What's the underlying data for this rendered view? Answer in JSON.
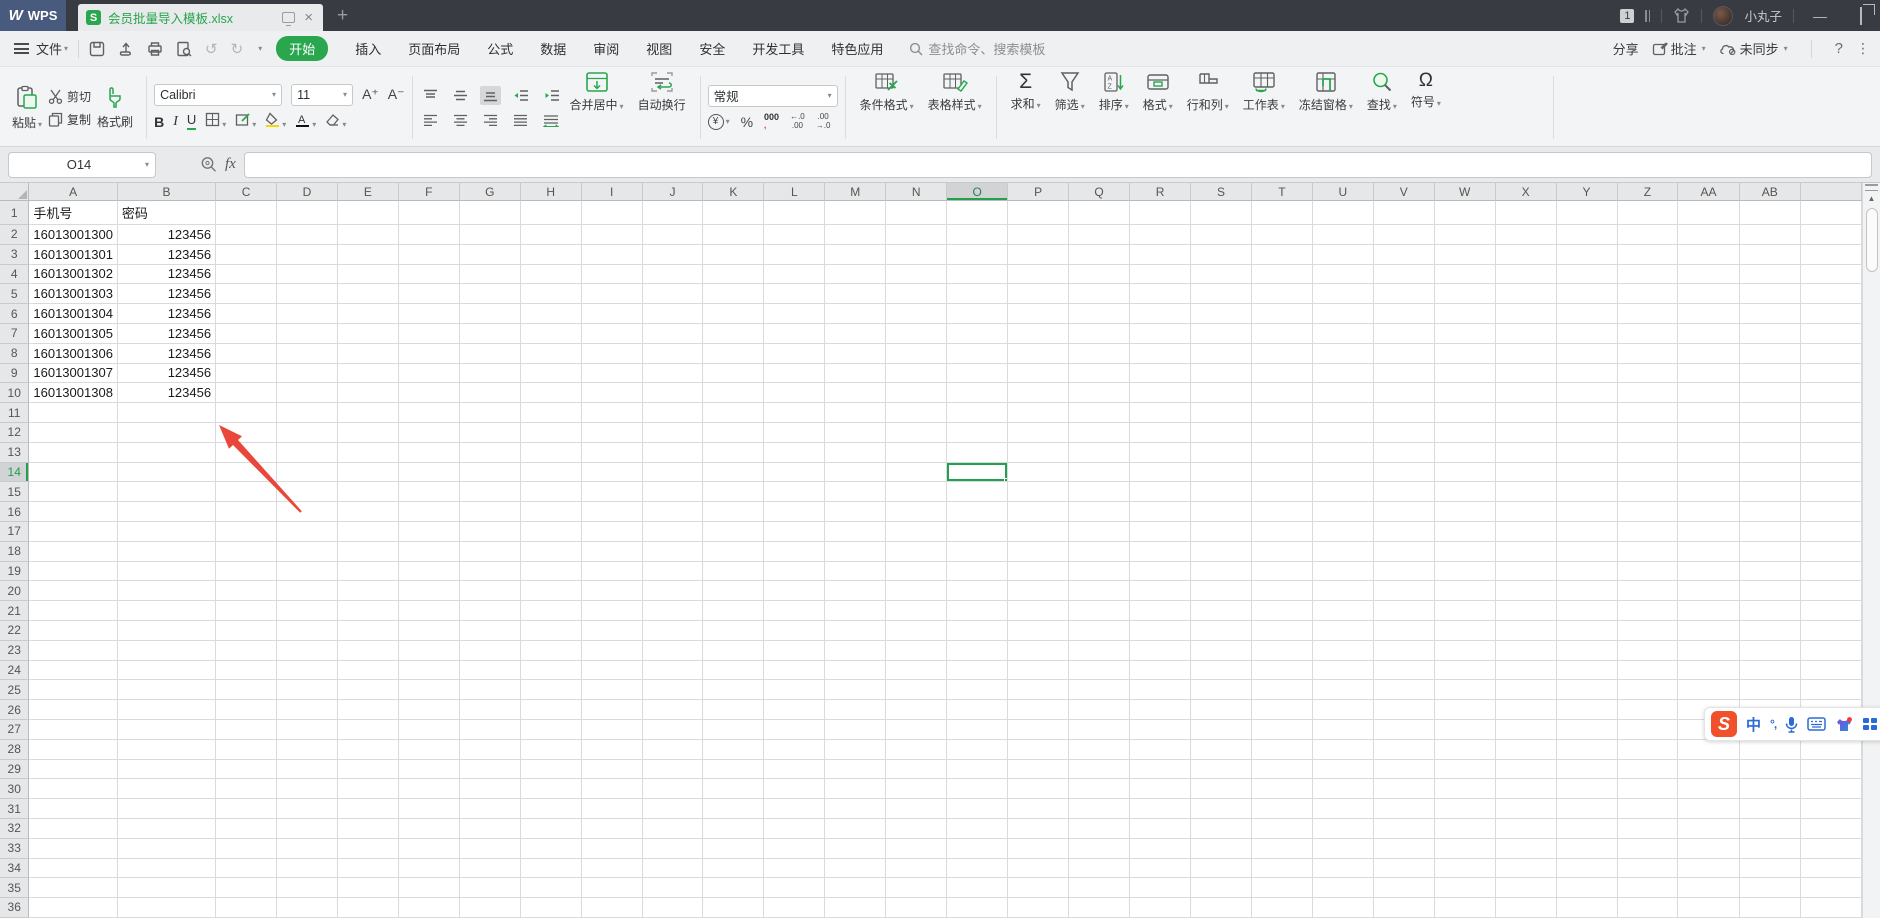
{
  "titlebar": {
    "app_name": "WPS",
    "document_title": "会员批量导入模板.xlsx",
    "notification_badge": "1",
    "username": "小丸子"
  },
  "menubar": {
    "file_label": "文件",
    "tabs": [
      {
        "id": "home",
        "label": "开始",
        "active": true
      },
      {
        "id": "insert",
        "label": "插入",
        "active": false
      },
      {
        "id": "page-layout",
        "label": "页面布局",
        "active": false
      },
      {
        "id": "formulas",
        "label": "公式",
        "active": false
      },
      {
        "id": "data",
        "label": "数据",
        "active": false
      },
      {
        "id": "review",
        "label": "审阅",
        "active": false
      },
      {
        "id": "view",
        "label": "视图",
        "active": false
      },
      {
        "id": "security",
        "label": "安全",
        "active": false
      },
      {
        "id": "dev-tools",
        "label": "开发工具",
        "active": false
      },
      {
        "id": "special-features",
        "label": "特色应用",
        "active": false
      }
    ],
    "search_text": "查找命令、搜索模板",
    "share_label": "分享",
    "comment_label": "批注",
    "sync_label": "未同步",
    "help_label": "?"
  },
  "ribbon": {
    "paste": "粘贴",
    "cut": "剪切",
    "copy": "复制",
    "format_painter": "格式刷",
    "font_name": "Calibri",
    "font_size": "11",
    "grow_font": "A⁺",
    "shrink_font": "A⁻",
    "bold": "B",
    "italic": "I",
    "underline": "U",
    "merge_center": "合并居中",
    "wrap_text": "自动换行",
    "number_format": "常规",
    "thousands": "000",
    "inc_decimal_top": "←.0",
    "inc_decimal_bottom": ".00",
    "dec_decimal_top": ".00",
    "dec_decimal_bottom": "→.0",
    "conditional_format": "条件格式",
    "table_style": "表格样式",
    "sum": "求和",
    "filter": "筛选",
    "sort": "排序",
    "format": "格式",
    "rows_cols": "行和列",
    "worksheet": "工作表",
    "freeze_panes": "冻结窗格",
    "find": "查找",
    "symbol": "符号"
  },
  "icons": {
    "sum_glyph": "Σ",
    "omega_glyph": "Ω",
    "percent_glyph": "%",
    "yuan_glyph": "¥",
    "undo_glyph": "↺",
    "redo_glyph": "↻",
    "plus_glyph": "+",
    "close_glyph": "×",
    "minimize_glyph": "—",
    "caret_glyph": "▾",
    "up_arrow_glyph": "▲",
    "more_dots_glyph": "⋮",
    "search_sort_az": "A↓Z"
  },
  "formula_bar": {
    "name_box": "O14",
    "fx_label": "fx",
    "value": ""
  },
  "sheet": {
    "columns": [
      "A",
      "B",
      "C",
      "D",
      "E",
      "F",
      "G",
      "H",
      "I",
      "J",
      "K",
      "L",
      "M",
      "N",
      "O",
      "P",
      "Q",
      "R",
      "S",
      "T",
      "U",
      "V",
      "W",
      "X",
      "Y",
      "Z",
      "AA",
      "AB"
    ],
    "visible_rows": 36,
    "selection_ref": "O14",
    "selected_column": "O",
    "selected_row": 14,
    "data_rows": [
      {
        "row": 1,
        "a": "手机号",
        "b": "密码"
      },
      {
        "row": 2,
        "a": "16013001300",
        "b": "123456"
      },
      {
        "row": 3,
        "a": "16013001301",
        "b": "123456"
      },
      {
        "row": 4,
        "a": "16013001302",
        "b": "123456"
      },
      {
        "row": 5,
        "a": "16013001303",
        "b": "123456"
      },
      {
        "row": 6,
        "a": "16013001304",
        "b": "123456"
      },
      {
        "row": 7,
        "a": "16013001305",
        "b": "123456"
      },
      {
        "row": 8,
        "a": "16013001306",
        "b": "123456"
      },
      {
        "row": 9,
        "a": "16013001307",
        "b": "123456"
      },
      {
        "row": 10,
        "a": "16013001308",
        "b": "123456"
      }
    ]
  },
  "ime_bar": {
    "logo_letter": "S",
    "mode_label": "中",
    "punct_label": "°,"
  },
  "colors": {
    "accent_green": "#2aa64f",
    "selection_green": "#1fa14d",
    "arrow_red": "#e8473a",
    "wps_blue": "#485a7e",
    "sogou_orange": "#f0502a",
    "ime_blue": "#2a6bd8"
  }
}
